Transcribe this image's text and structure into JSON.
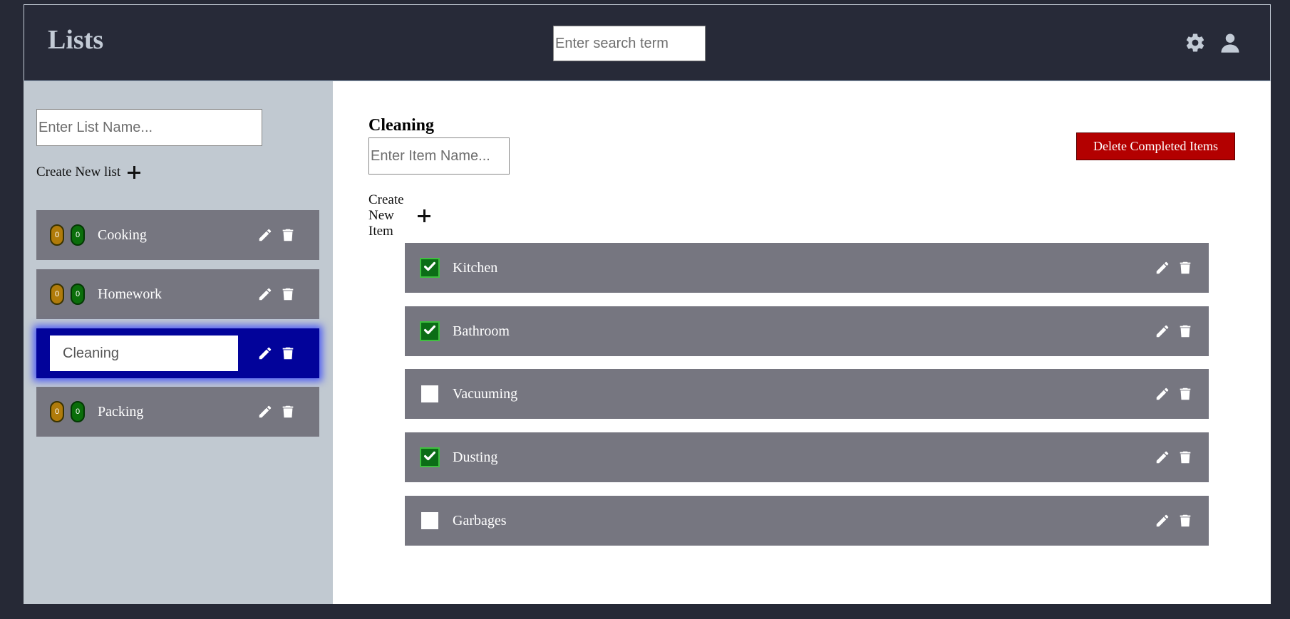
{
  "header": {
    "title": "Lists",
    "search_placeholder": "Enter search term"
  },
  "sidebar": {
    "list_name_placeholder": "Enter List Name...",
    "create_list_label": "Create New list",
    "lists": [
      {
        "name": "Cooking",
        "pending_count": "0",
        "done_count": "0",
        "active": false
      },
      {
        "name": "Homework",
        "pending_count": "0",
        "done_count": "0",
        "active": false
      },
      {
        "name": "Cleaning",
        "pending_count": "",
        "done_count": "",
        "active": true
      },
      {
        "name": "Packing",
        "pending_count": "0",
        "done_count": "0",
        "active": false
      }
    ]
  },
  "main": {
    "list_title": "Cleaning",
    "item_name_placeholder": "Enter Item Name...",
    "create_item_label": "Create New Item",
    "delete_completed_label": "Delete Completed Items",
    "items": [
      {
        "name": "Kitchen",
        "checked": true
      },
      {
        "name": "Bathroom",
        "checked": true
      },
      {
        "name": "Vacuuming",
        "checked": false
      },
      {
        "name": "Dusting",
        "checked": true
      },
      {
        "name": "Garbages",
        "checked": false
      }
    ]
  },
  "colors": {
    "header_bg": "#272a38",
    "sidebar_bg": "#c1c9d1",
    "row_bg": "#767680",
    "active_row_bg": "#02039a",
    "pending_badge": "#b07b0a",
    "done_badge": "#0a6e0a",
    "delete_button": "#b30000"
  },
  "icons": {
    "settings": "gear-icon",
    "profile": "user-icon",
    "edit": "pencil-icon",
    "delete": "trash-icon",
    "add": "plus-icon",
    "checked": "checkmark-icon"
  }
}
